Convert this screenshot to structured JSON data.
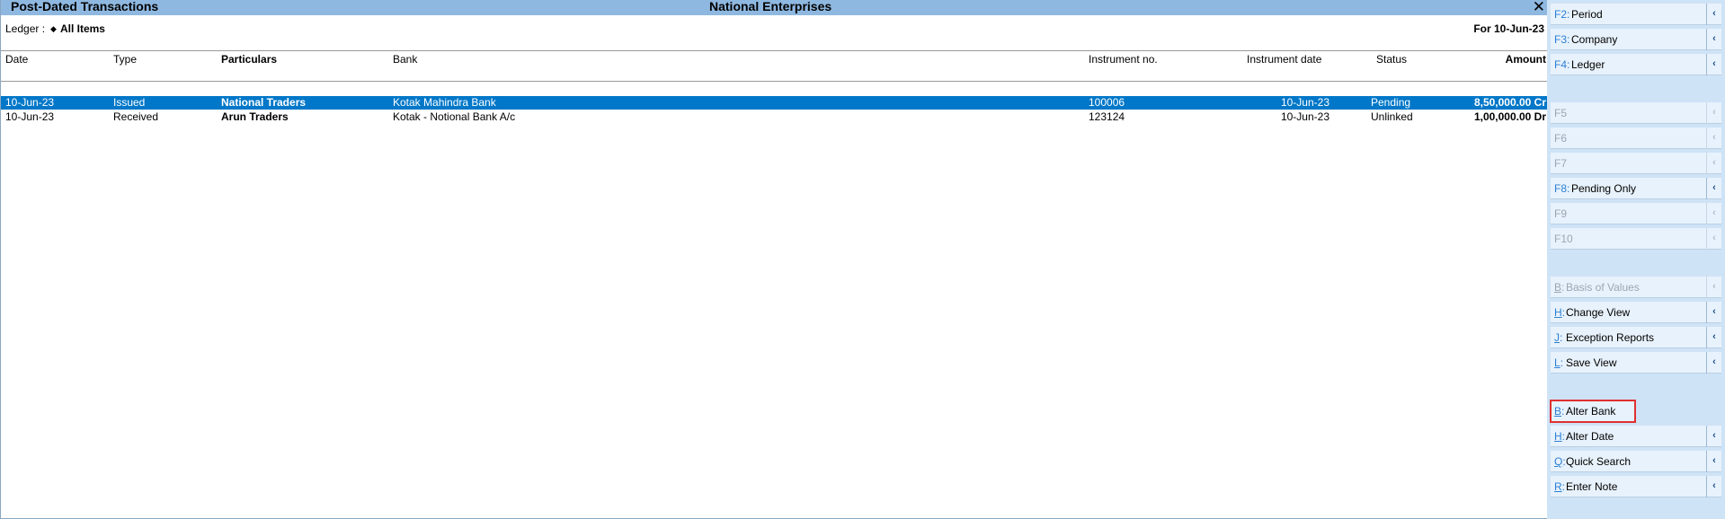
{
  "window": {
    "report_title": "Post-Dated Transactions",
    "company": "National Enterprises",
    "close_glyph": "✕"
  },
  "filter": {
    "ledger_label": "Ledger :",
    "ledger_value": "All Items",
    "date_label": "For 10-Jun-23"
  },
  "table": {
    "headers": {
      "date": "Date",
      "type": "Type",
      "particulars": "Particulars",
      "bank": "Bank",
      "instrument_no": "Instrument no.",
      "instrument_date": "Instrument date",
      "status": "Status",
      "amount": "Amount"
    },
    "rows": [
      {
        "date": "10-Jun-23",
        "type": "Issued",
        "particulars": "National Traders",
        "bank": "Kotak Mahindra Bank",
        "instrument_no": "100006",
        "instrument_date": "10-Jun-23",
        "status": "Pending",
        "amount": "8,50,000.00 Cr",
        "selected": true
      },
      {
        "date": "10-Jun-23",
        "type": "Received",
        "particulars": "Arun Traders",
        "bank": "Kotak - Notional Bank A/c",
        "instrument_no": "123124",
        "instrument_date": "10-Jun-23",
        "status": "Unlinked",
        "amount": "1,00,000.00 Dr",
        "selected": false
      }
    ]
  },
  "sidebar": {
    "buttons": [
      {
        "key": "F2",
        "label": "Period",
        "enabled": true
      },
      {
        "key": "F3",
        "label": "Company",
        "enabled": true
      },
      {
        "key": "F4",
        "label": "Ledger",
        "enabled": true
      },
      {
        "key": "F5",
        "label": "",
        "enabled": false
      },
      {
        "key": "F6",
        "label": "",
        "enabled": false
      },
      {
        "key": "F7",
        "label": "",
        "enabled": false
      },
      {
        "key": "F8",
        "label": "Pending Only",
        "enabled": true
      },
      {
        "key": "F9",
        "label": "",
        "enabled": false
      },
      {
        "key": "F10",
        "label": "",
        "enabled": false
      },
      {
        "key": "B",
        "label": "Basis of Values",
        "enabled": false
      },
      {
        "key": "H",
        "label": "Change View",
        "enabled": true
      },
      {
        "key": "J",
        "label": "Exception Reports",
        "enabled": true
      },
      {
        "key": "L",
        "label": "Save View",
        "enabled": true
      },
      {
        "key": "B",
        "label": "Alter Bank",
        "enabled": true,
        "highlight": true
      },
      {
        "key": "H",
        "label": "Alter Date",
        "enabled": true
      },
      {
        "key": "Q",
        "label": "Quick Search",
        "enabled": true
      },
      {
        "key": "R",
        "label": "Enter Note",
        "enabled": true
      }
    ]
  }
}
